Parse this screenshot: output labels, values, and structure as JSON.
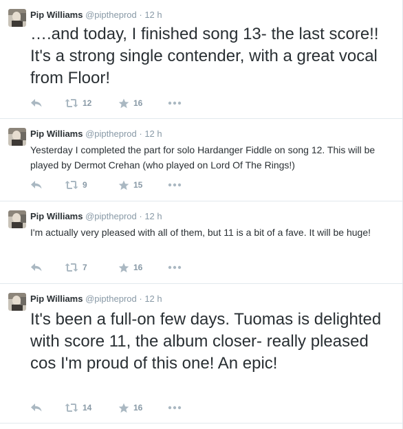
{
  "tweets": [
    {
      "name": "Pip Williams",
      "handle": "@piptheprod",
      "separator": "·",
      "time": "12 h",
      "text": "….and today, I finished song 13- the last score!! It's a strong single contender, with a great vocal from Floor!",
      "retweets": "12",
      "favorites": "16"
    },
    {
      "name": "Pip Williams",
      "handle": "@piptheprod",
      "separator": "·",
      "time": "12 h",
      "text": "Yesterday I completed the part for solo Hardanger Fiddle on song 12. This will be played by Dermot Crehan (who played on Lord Of The Rings!)",
      "retweets": "9",
      "favorites": "15"
    },
    {
      "name": "Pip Williams",
      "handle": "@piptheprod",
      "separator": "·",
      "time": "12 h",
      "text": "I'm actually very pleased with all of them, but 11 is a bit of a fave. It will be huge!",
      "retweets": "7",
      "favorites": "16"
    },
    {
      "name": "Pip Williams",
      "handle": "@piptheprod",
      "separator": "·",
      "time": "12 h",
      "text": "It's been a full-on few days. Tuomas is delighted with score 11, the album closer- really pleased cos I'm proud of this one! An epic!",
      "retweets": "14",
      "favorites": "16"
    }
  ],
  "icons": {
    "reply": "reply-icon",
    "retweet": "retweet-icon",
    "favorite": "star-icon",
    "more": "more-dots-icon",
    "avatar": "avatar"
  },
  "colors": {
    "name": "#292f33",
    "meta": "#8899a6",
    "action_icon": "#aab8c2",
    "divider": "#e1e8ed"
  }
}
